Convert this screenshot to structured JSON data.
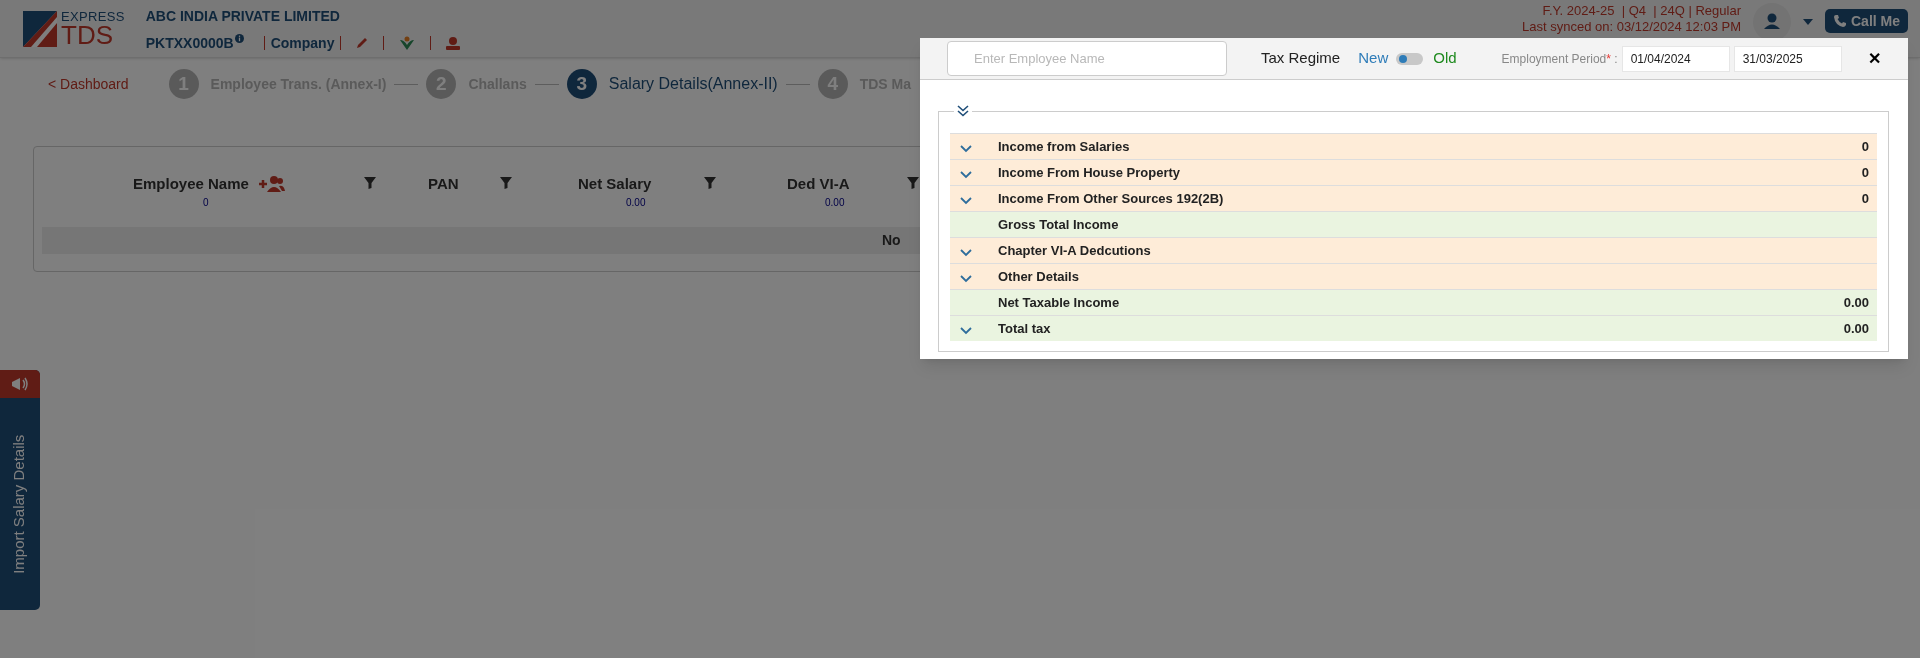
{
  "header": {
    "logo": {
      "line1": "EXPRESS",
      "line2": "TDS"
    },
    "company": "ABC INDIA PRIVATE LIMITED",
    "pan": "PKTXX0000B",
    "role": "Company",
    "filing": "F.Y. 2024-25  | Q4  | 24Q | Regular",
    "sync": "Last synced on: 03/12/2024 12:03 PM",
    "call_button": "Call Me"
  },
  "steps": {
    "back_link": "< Dashboard",
    "items": [
      {
        "number": "1",
        "label": "Employee Trans. (Annex-I)",
        "selected": false
      },
      {
        "number": "2",
        "label": "Challans",
        "selected": false
      },
      {
        "number": "3",
        "label": "Salary Details(Annex-II)",
        "selected": true
      },
      {
        "number": "4",
        "label": "TDS Ma",
        "selected": false
      }
    ]
  },
  "table": {
    "columns": [
      {
        "label": "Employee Name",
        "total": "0",
        "add_icon": true
      },
      {
        "label": "PAN"
      },
      {
        "label": "Net Salary",
        "total": "0.00"
      },
      {
        "label": "Ded VI-A",
        "total": "0.00"
      }
    ],
    "empty_text": "No"
  },
  "side_tab": "Import Salary Details",
  "modal": {
    "search": {
      "placeholder": "Enter Employee Name"
    },
    "tax_regime": {
      "label": "Tax Regime",
      "new": "New",
      "old": "Old",
      "old_selected": false
    },
    "employment_period": {
      "label": "Employment Period",
      "required_mark": "*",
      "separator": ":",
      "from": "01/04/2024",
      "to": "31/03/2025"
    },
    "close": "✕",
    "rows": [
      {
        "kind": "section",
        "expandable": true,
        "label": "Income from Salaries",
        "value": "0"
      },
      {
        "kind": "section",
        "expandable": true,
        "label": "Income From House Property",
        "value": "0"
      },
      {
        "kind": "section",
        "expandable": true,
        "label": "Income From Other Sources 192(2B)",
        "value": "0"
      },
      {
        "kind": "summary",
        "expandable": false,
        "label": "Gross Total Income"
      },
      {
        "kind": "section",
        "expandable": true,
        "label": "Chapter VI-A Dedcutions"
      },
      {
        "kind": "section",
        "expandable": true,
        "label": "Other Details"
      },
      {
        "kind": "summary",
        "expandable": false,
        "label": "Net Taxable Income",
        "value": "0.00"
      },
      {
        "kind": "summary",
        "expandable": true,
        "label": "Total tax",
        "value": "0.00"
      }
    ]
  }
}
